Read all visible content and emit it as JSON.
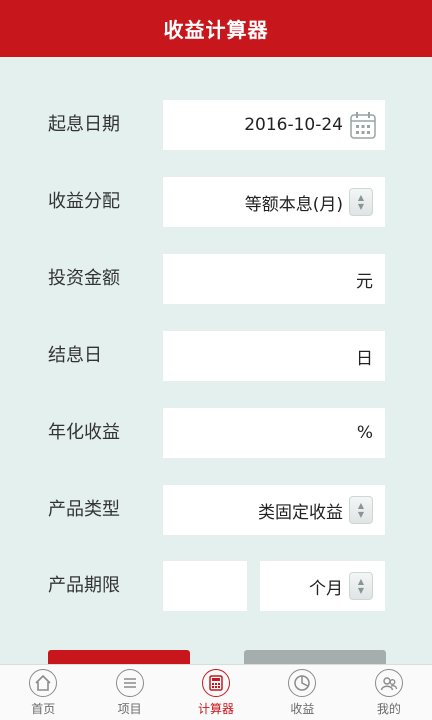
{
  "header": {
    "title": "收益计算器"
  },
  "form": {
    "start_date": {
      "label": "起息日期",
      "value": "2016-10-24"
    },
    "distribution": {
      "label": "收益分配",
      "value": "等额本息(月)"
    },
    "amount": {
      "label": "投资金额",
      "value": "",
      "unit": "元"
    },
    "settle_day": {
      "label": "结息日",
      "value": "",
      "unit": "日"
    },
    "annual_yield": {
      "label": "年化收益",
      "value": "",
      "unit": "%"
    },
    "product_type": {
      "label": "产品类型",
      "value": "类固定收益"
    },
    "term": {
      "label": "产品期限",
      "value": "",
      "unit": "个月"
    }
  },
  "tabbar": {
    "items": [
      {
        "label": "首页",
        "icon": "home-icon"
      },
      {
        "label": "项目",
        "icon": "list-icon"
      },
      {
        "label": "计算器",
        "icon": "calculator-icon"
      },
      {
        "label": "收益",
        "icon": "pie-chart-icon"
      },
      {
        "label": "我的",
        "icon": "user-icon"
      }
    ],
    "active_index": 2
  },
  "colors": {
    "accent": "#c8171c",
    "background": "#e4f0ee",
    "tab_inactive": "#6a6a6a"
  }
}
